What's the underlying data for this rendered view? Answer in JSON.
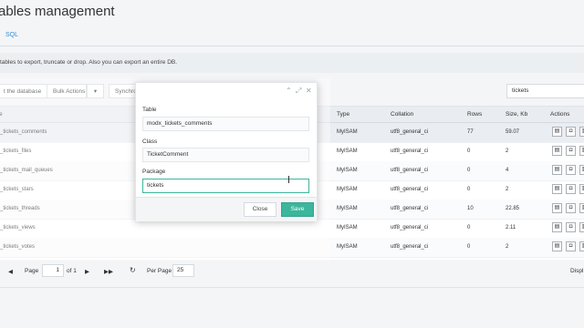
{
  "page": {
    "title": "ables management"
  },
  "tabs": {
    "sql": "SQL"
  },
  "description": "tables to export, truncate or drop. Also you can export an entire DB.",
  "toolbar": {
    "export_db": "t the database",
    "bulk_actions": "Bulk Actions",
    "bulk_caret": "▾",
    "synchronize": "Synchro",
    "search_value": "tickets"
  },
  "grid": {
    "headers": {
      "name": "e",
      "type": "Type",
      "collation": "Collation",
      "rows": "Rows",
      "size": "Size, Kb",
      "actions": "Actions"
    },
    "rows": [
      {
        "name": "_tickets_comments",
        "type": "MyISAM",
        "collation": "utf8_general_ci",
        "rows": "77",
        "size": "59.07"
      },
      {
        "name": "_tickets_files",
        "type": "MyISAM",
        "collation": "utf8_general_ci",
        "rows": "0",
        "size": "2"
      },
      {
        "name": "_tickets_mail_queues",
        "type": "MyISAM",
        "collation": "utf8_general_ci",
        "rows": "0",
        "size": "4"
      },
      {
        "name": "_tickets_stars",
        "type": "MyISAM",
        "collation": "utf8_general_ci",
        "rows": "0",
        "size": "2"
      },
      {
        "name": "_tickets_threads",
        "type": "MyISAM",
        "collation": "utf8_general_ci",
        "rows": "10",
        "size": "22.85"
      },
      {
        "name": "_tickets_views",
        "type": "MyISAM",
        "collation": "utf8_general_ci",
        "rows": "0",
        "size": "2.11"
      },
      {
        "name": "_tickets_votes",
        "type": "MyISAM",
        "collation": "utf8_general_ci",
        "rows": "0",
        "size": "2"
      }
    ]
  },
  "pager": {
    "prev": "◀",
    "page_label": "Page",
    "page_value": "1",
    "of_label": "of 1",
    "next": "▶",
    "last": "▶▶",
    "refresh": "↻",
    "per_page_label": "Per Page",
    "per_page_value": "25",
    "display": "Displ"
  },
  "modal": {
    "tools": {
      "collapse": "⌃",
      "expand": "⤢",
      "close": "✕"
    },
    "table_label": "Table",
    "table_value": "modx_tickets_comments",
    "class_label": "Class",
    "class_value": "TicketComment",
    "package_label": "Package",
    "package_value": "tickets",
    "close_button": "Close",
    "save_button": "Save"
  },
  "icons": {
    "action1": "▤",
    "action2": "◘",
    "action3": "▥"
  },
  "colors": {
    "accent": "#3cb69c",
    "link": "#3a8ad0"
  }
}
